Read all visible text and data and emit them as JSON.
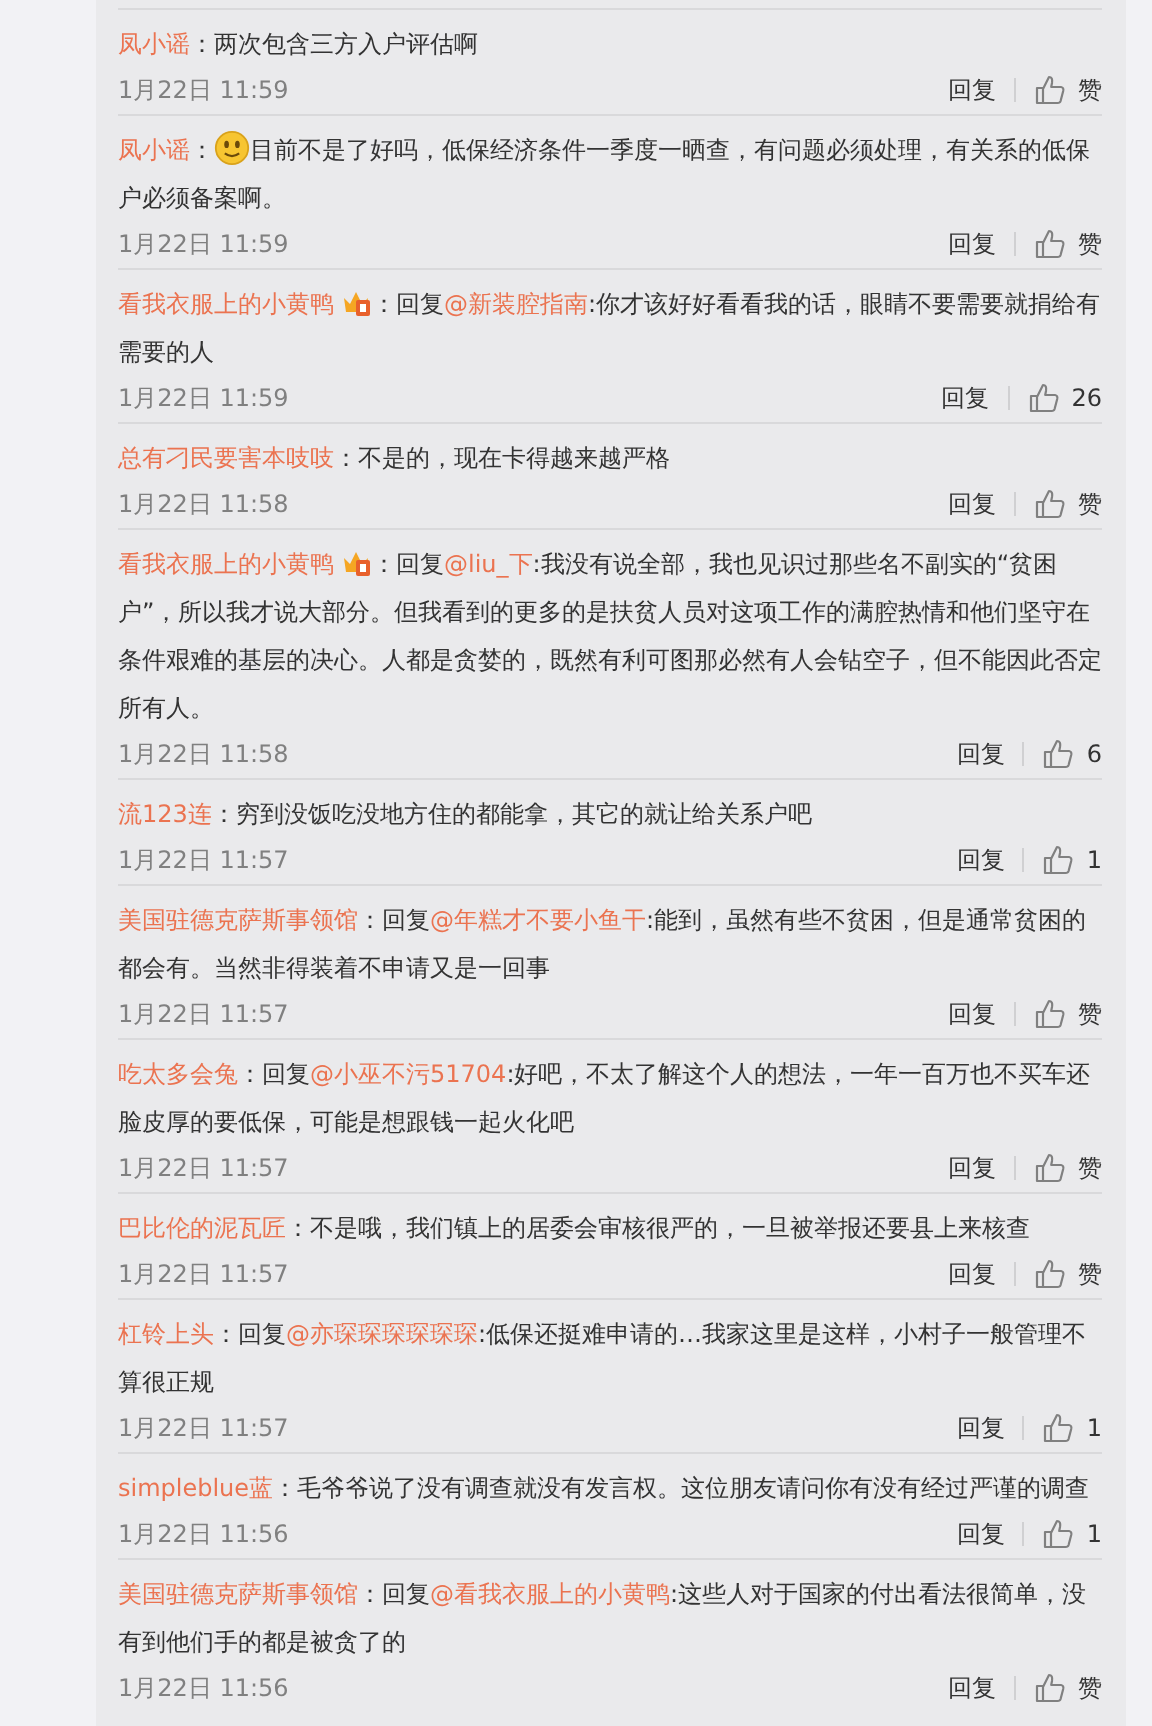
{
  "comments": [
    {
      "user": "凤小谣",
      "badge": false,
      "body": [
        {
          "kind": "text",
          "text": "：两次包含三方入户评估啊"
        }
      ],
      "time": "1月22日 11:59",
      "reply": "回复",
      "likes": "赞"
    },
    {
      "user": "凤小谣",
      "badge": false,
      "body": [
        {
          "kind": "text",
          "text": "："
        },
        {
          "kind": "emoji"
        },
        {
          "kind": "text",
          "text": "目前不是了好吗，低保经济条件一季度一晒查，有问题必须处理，有关系的低保户必须备案啊。"
        }
      ],
      "time": "1月22日 11:59",
      "reply": "回复",
      "likes": "赞"
    },
    {
      "user": "看我衣服上的小黄鸭",
      "badge": true,
      "body": [
        {
          "kind": "text",
          "text": "：回复"
        },
        {
          "kind": "mention",
          "text": "@新装腔指南"
        },
        {
          "kind": "text",
          "text": ":你才该好好看看我的话，眼睛不要需要就捐给有需要的人"
        }
      ],
      "time": "1月22日 11:59",
      "reply": "回复",
      "likes": "26"
    },
    {
      "user": "总有刁民要害本吱吱",
      "badge": false,
      "body": [
        {
          "kind": "text",
          "text": "：不是的，现在卡得越来越严格"
        }
      ],
      "time": "1月22日 11:58",
      "reply": "回复",
      "likes": "赞"
    },
    {
      "user": "看我衣服上的小黄鸭",
      "badge": true,
      "body": [
        {
          "kind": "text",
          "text": "：回复"
        },
        {
          "kind": "mention",
          "text": "@liu_下"
        },
        {
          "kind": "text",
          "text": ":我没有说全部，我也见识过那些名不副实的“贫困户”，所以我才说大部分。但我看到的更多的是扶贫人员对这项工作的满腔热情和他们坚守在条件艰难的基层的决心。人都是贪婪的，既然有利可图那必然有人会钻空子，但不能因此否定所有人。"
        }
      ],
      "time": "1月22日 11:58",
      "reply": "回复",
      "likes": "6"
    },
    {
      "user": "流123连",
      "badge": false,
      "body": [
        {
          "kind": "text",
          "text": "：穷到没饭吃没地方住的都能拿，其它的就让给关系户吧"
        }
      ],
      "time": "1月22日 11:57",
      "reply": "回复",
      "likes": "1"
    },
    {
      "user": "美国驻德克萨斯事领馆",
      "badge": false,
      "body": [
        {
          "kind": "text",
          "text": "：回复"
        },
        {
          "kind": "mention",
          "text": "@年糕才不要小鱼干"
        },
        {
          "kind": "text",
          "text": ":能到，虽然有些不贫困，但是通常贫困的都会有。当然非得装着不申请又是一回事"
        }
      ],
      "time": "1月22日 11:57",
      "reply": "回复",
      "likes": "赞"
    },
    {
      "user": "吃太多会兔",
      "badge": false,
      "body": [
        {
          "kind": "text",
          "text": "：回复"
        },
        {
          "kind": "mention",
          "text": "@小巫不污51704"
        },
        {
          "kind": "text",
          "text": ":好吧，不太了解这个人的想法，一年一百万也不买车还脸皮厚的要低保，可能是想跟钱一起火化吧"
        }
      ],
      "time": "1月22日 11:57",
      "reply": "回复",
      "likes": "赞"
    },
    {
      "user": "巴比伦的泥瓦匠",
      "badge": false,
      "body": [
        {
          "kind": "text",
          "text": "：不是哦，我们镇上的居委会审核很严的，一旦被举报还要县上来核查"
        }
      ],
      "time": "1月22日 11:57",
      "reply": "回复",
      "likes": "赞"
    },
    {
      "user": "杠铃上头",
      "badge": false,
      "body": [
        {
          "kind": "text",
          "text": "：回复"
        },
        {
          "kind": "mention",
          "text": "@亦琛琛琛琛琛琛"
        },
        {
          "kind": "text",
          "text": ":低保还挺难申请的…我家这里是这样，小村子一般管理不算很正规"
        }
      ],
      "time": "1月22日 11:57",
      "reply": "回复",
      "likes": "1"
    },
    {
      "user": "simpleblue蓝",
      "badge": false,
      "body": [
        {
          "kind": "text",
          "text": "：毛爷爷说了没有调查就没有发言权。这位朋友请问你有没有经过严谨的调查"
        }
      ],
      "time": "1月22日 11:56",
      "reply": "回复",
      "likes": "1"
    },
    {
      "user": "美国驻德克萨斯事领馆",
      "badge": false,
      "body": [
        {
          "kind": "text",
          "text": "：回复"
        },
        {
          "kind": "mention",
          "text": "@看我衣服上的小黄鸭"
        },
        {
          "kind": "text",
          "text": ":这些人对于国家的付出看法很简单，没有到他们手的都是被贪了的"
        }
      ],
      "time": "1月22日 11:56",
      "reply": "回复",
      "likes": "赞"
    }
  ]
}
